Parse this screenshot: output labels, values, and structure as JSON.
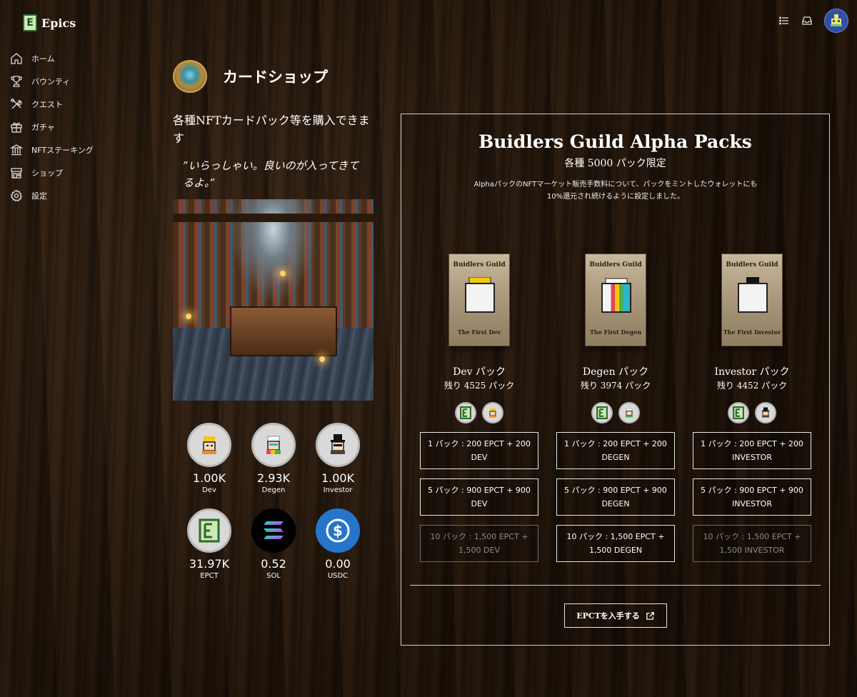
{
  "brand": {
    "name": "Epics"
  },
  "sidebar": {
    "items": [
      {
        "label": "ホーム",
        "icon": "home-icon"
      },
      {
        "label": "バウンティ",
        "icon": "trophy-icon"
      },
      {
        "label": "クエスト",
        "icon": "tools-icon"
      },
      {
        "label": "ガチャ",
        "icon": "gift-icon"
      },
      {
        "label": "NFTステーキング",
        "icon": "bank-icon"
      },
      {
        "label": "ショップ",
        "icon": "shop-icon"
      },
      {
        "label": "設定",
        "icon": "gear-icon"
      }
    ]
  },
  "page": {
    "title": "カードショップ",
    "intro": "各種NFTカードパック等を購入できます",
    "quote": "”いらっしゃい。良いのが入ってきてるよ。”"
  },
  "holdings": [
    {
      "value": "1.00K",
      "label": "Dev",
      "icon": "dev-coin-icon"
    },
    {
      "value": "2.93K",
      "label": "Degen",
      "icon": "degen-coin-icon"
    },
    {
      "value": "1.00K",
      "label": "Investor",
      "icon": "investor-coin-icon"
    },
    {
      "value": "31.97K",
      "label": "EPCT",
      "icon": "epct-coin-icon"
    },
    {
      "value": "0.52",
      "label": "SOL",
      "icon": "sol-coin-icon"
    },
    {
      "value": "0.00",
      "label": "USDC",
      "icon": "usdc-coin-icon"
    }
  ],
  "panel": {
    "title": "Buidlers Guild Alpha Packs",
    "subtitle": "各種 5000 パック限定",
    "description": "AlphaパックのNFTマーケット販売手数料について、パックをミントしたウォレットにも10%還元され続けるように設定しました。",
    "get_button": "EPCTを入手する",
    "packs": [
      {
        "art_title": "Buidlers Guild",
        "art_footer": "The First Dev",
        "name": "Dev パック",
        "remaining": "残り 4525 パック",
        "buttons": [
          {
            "label": "1 パック : 200 EPCT + 200 DEV",
            "disabled": false
          },
          {
            "label": "5 パック : 900 EPCT + 900 DEV",
            "disabled": false
          },
          {
            "label": "10 パック : 1,500 EPCT + 1,500 DEV",
            "disabled": true
          }
        ]
      },
      {
        "art_title": "Buidlers Guild",
        "art_footer": "The First Degen",
        "name": "Degen パック",
        "remaining": "残り 3974 パック",
        "buttons": [
          {
            "label": "1 パック : 200 EPCT + 200 DEGEN",
            "disabled": false
          },
          {
            "label": "5 パック : 900 EPCT + 900 DEGEN",
            "disabled": false
          },
          {
            "label": "10 パック : 1,500 EPCT + 1,500 DEGEN",
            "disabled": false
          }
        ]
      },
      {
        "art_title": "Buidlers Guild",
        "art_footer": "The First Investor",
        "name": "Investor パック",
        "remaining": "残り 4452 パック",
        "buttons": [
          {
            "label": "1 パック : 200 EPCT + 200 INVESTOR",
            "disabled": false
          },
          {
            "label": "5 パック : 900 EPCT + 900 INVESTOR",
            "disabled": false
          },
          {
            "label": "10 パック : 1,500 EPCT + 1,500 INVESTOR",
            "disabled": true
          }
        ]
      }
    ]
  },
  "colors": {
    "accent_green": "#2d6a2a",
    "sol_purple": "#8b5cf6",
    "usdc_blue": "#2775ca",
    "avatar_blue": "#2f4fa8"
  }
}
